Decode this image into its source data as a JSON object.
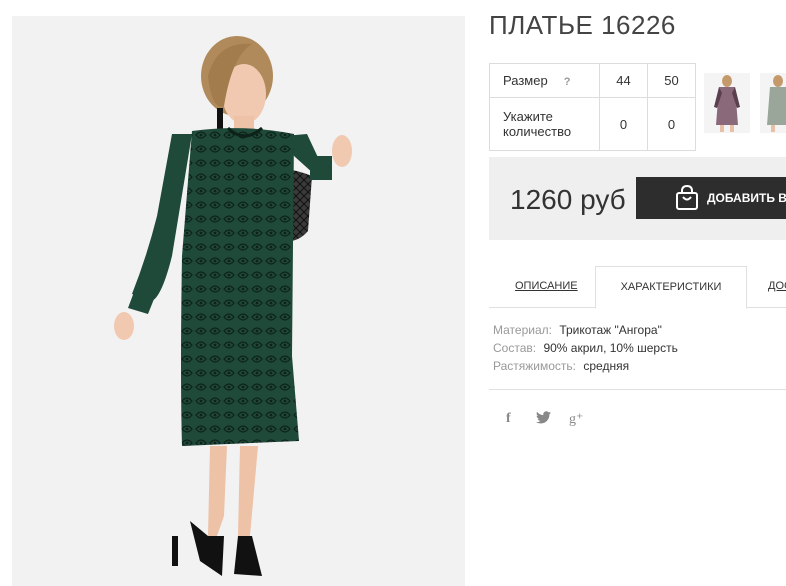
{
  "product": {
    "title": "ПЛАТЬЕ 16226",
    "price": "1260 руб",
    "add_to_cart_label": "ДОБАВИТЬ В З"
  },
  "size_table": {
    "size_label": "Размер",
    "help_icon": "?",
    "sizes": [
      "44",
      "50"
    ],
    "qty_label": "Укажите количество",
    "qty": [
      "0",
      "0"
    ]
  },
  "thumbnails": [
    "thumbnail-1",
    "thumbnail-2"
  ],
  "tabs": [
    {
      "label": "ОПИСАНИЕ",
      "active": false
    },
    {
      "label": "ХАРАКТЕРИСТИКИ",
      "active": true
    },
    {
      "label": "ДОС",
      "active": false
    }
  ],
  "specs": [
    {
      "label": "Материал:",
      "value": "Трикотаж \"Ангора\""
    },
    {
      "label": "Состав:",
      "value": "90% акрил, 10% шерсть"
    },
    {
      "label": "Растяжимость:",
      "value": "средняя"
    }
  ],
  "social": [
    {
      "icon": "facebook-icon",
      "glyph": "f"
    },
    {
      "icon": "twitter-icon",
      "glyph": "🐦"
    },
    {
      "icon": "google-plus-icon",
      "glyph": "g⁺"
    }
  ],
  "colors": {
    "dress_green": "#1f4a3a",
    "button_dark": "#2d2d2d",
    "buybox_bg": "#efefef"
  }
}
